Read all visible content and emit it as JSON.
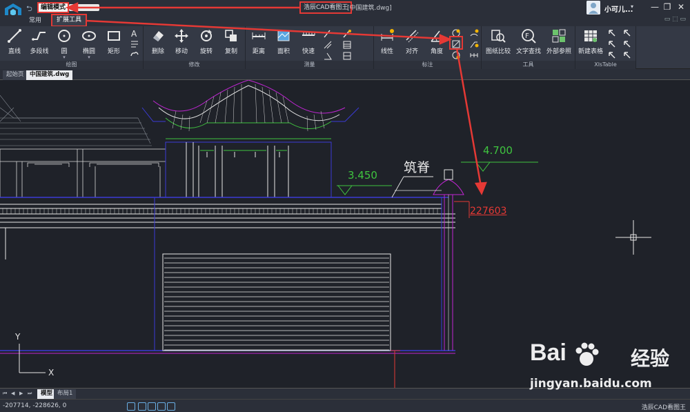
{
  "titlebar": {
    "edit_mode": "编辑模式",
    "app_title": "浩辰CAD看图王",
    "file_title": "[中国建筑.dwg]",
    "user_name": "小可儿...",
    "min": "—",
    "restore": "❐",
    "close": "✕"
  },
  "tabs": {
    "common": "常用",
    "extension": "扩展工具",
    "ribbon_controls": "▭ ⬚ ▭"
  },
  "ribbon": {
    "groups": {
      "draw": "绘图",
      "modify": "修改",
      "measure": "测量",
      "annotate": "标注",
      "tools": "工具",
      "xls": "XlsTable"
    },
    "buttons": {
      "line": "直线",
      "polyline": "多段线",
      "circle": "圆",
      "ellipse": "椭圆",
      "rectangle": "矩形",
      "delete": "删除",
      "move": "移动",
      "rotate": "旋转",
      "copy": "复制",
      "distance": "距离",
      "area": "面积",
      "quick": "快速",
      "linear": "线性",
      "aligned": "对齐",
      "angle": "角度",
      "compare": "图纸比较",
      "text_search": "文字查找",
      "xref": "外部参照",
      "new_table": "新建表格"
    },
    "dropdown_glyph": "▾"
  },
  "doctabs": {
    "start": "起始页",
    "file": "中国建筑.dwg"
  },
  "drawing": {
    "elevation_a": "3.450",
    "elevation_b": "4.700",
    "ridge_label": "筑脊",
    "dimension_value": "227603",
    "axis_y": "Y",
    "axis_x": "X"
  },
  "layout_tabs": {
    "model": "模型",
    "layout1": "布局1",
    "nav": [
      "⏮",
      "◀",
      "▶",
      "⏭"
    ]
  },
  "status": {
    "coords": "-207714, -228626, 0",
    "app_name": "浩辰CAD看图王"
  },
  "watermark": {
    "brand_a": "Bai",
    "brand_b": "经验",
    "url": "jingyan.baidu.com"
  },
  "colors": {
    "annotation_red": "#e53935",
    "cad_green": "#3fc43f",
    "cad_magenta": "#c026d3",
    "cad_blue": "#3b3bd6",
    "canvas_bg": "#1f2229"
  }
}
